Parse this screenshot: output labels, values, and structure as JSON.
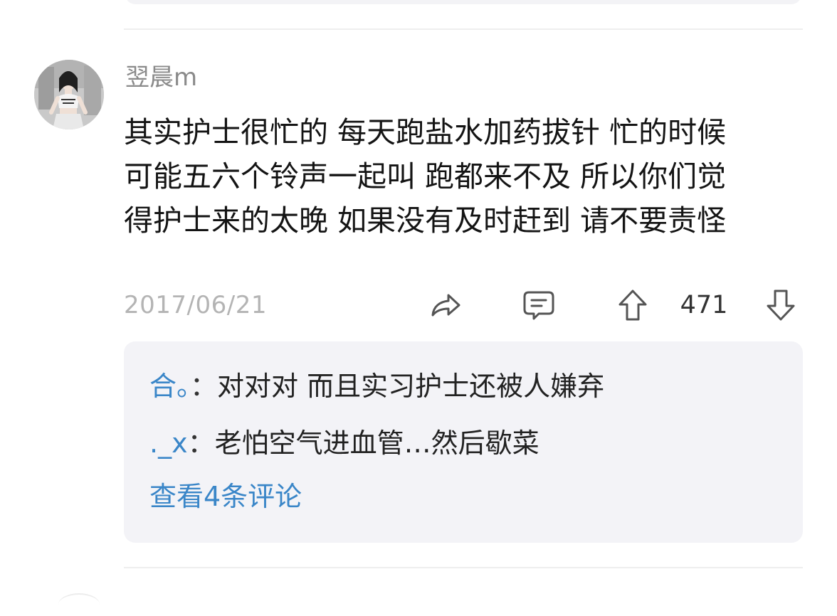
{
  "post": {
    "username": "翌晨m",
    "avatar_icon": "user-avatar-photo",
    "content_lines": [
      "其实护士很忙的 每天跑盐水加药拔针 忙的时候",
      "可能五六个铃声一起叫 跑都来不及 所以你们觉",
      "得护士来的太晚 如果没有及时赶到 请不要责怪"
    ],
    "date": "2017/06/21",
    "actions": {
      "share_icon": "share-icon",
      "reply_icon": "comment-icon",
      "upvote_icon": "arrow-up-icon",
      "vote_count": "471",
      "downvote_icon": "arrow-down-icon"
    }
  },
  "replies": {
    "items": [
      {
        "author": "合。",
        "separator": "：",
        "text": "对对对   而且实习护士还被人嫌弃"
      },
      {
        "author": "._x",
        "separator": "：",
        "text": "老怕空气进血管…然后歇菜"
      }
    ],
    "view_more": "查看4条评论"
  },
  "colors": {
    "link_blue": "#3a86c8",
    "reply_box_bg": "#f3f3f7",
    "meta_gray": "#b4b4b4"
  }
}
